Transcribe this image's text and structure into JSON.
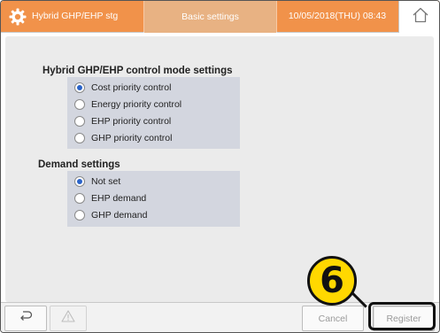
{
  "header": {
    "app_title": "Hybrid GHP/EHP stg",
    "screen_title": "Basic settings",
    "datetime": "10/05/2018(THU) 08:43",
    "settings_icon": "gear-icon",
    "home_icon": "home-icon"
  },
  "control_mode": {
    "title": "Hybrid GHP/EHP control mode settings",
    "options": [
      {
        "label": "Cost priority control",
        "selected": true
      },
      {
        "label": "Energy priority control",
        "selected": false
      },
      {
        "label": "EHP priority control",
        "selected": false
      },
      {
        "label": "GHP priority control",
        "selected": false
      }
    ]
  },
  "demand": {
    "title": "Demand settings",
    "options": [
      {
        "label": "Not set",
        "selected": true
      },
      {
        "label": "EHP demand",
        "selected": false
      },
      {
        "label": "GHP demand",
        "selected": false
      }
    ]
  },
  "footer": {
    "back_icon": "back-arrow-icon",
    "warning_icon": "warning-icon",
    "cancel_label": "Cancel",
    "register_label": "Register"
  },
  "callout": {
    "number": "6"
  },
  "colors": {
    "header_orange": "#f1924a",
    "header_tab": "#e8b283",
    "group_bg": "#d3d6df",
    "radio_selected": "#2a63c8",
    "callout_yellow": "#ffd800"
  }
}
